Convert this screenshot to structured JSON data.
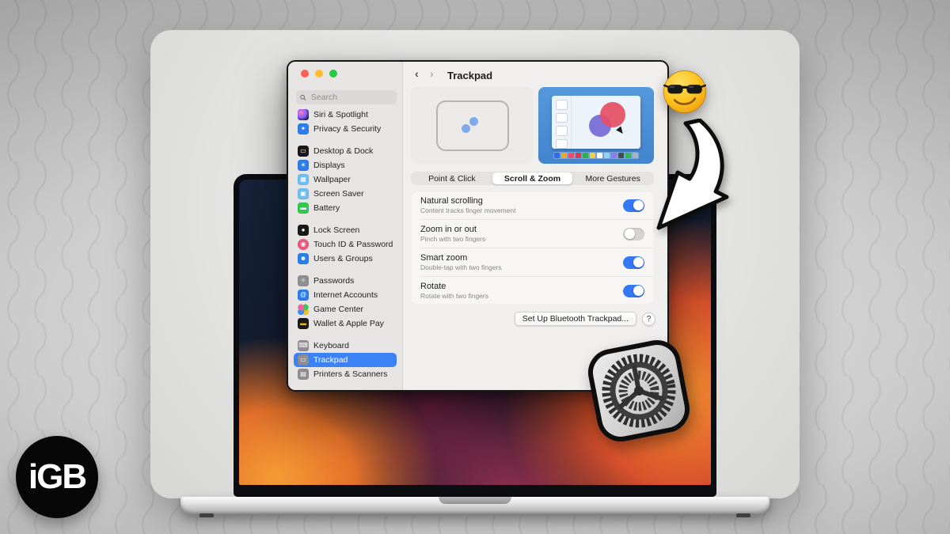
{
  "poster": {
    "logo": {
      "text": "iGB",
      "bg": "#070707",
      "fg": "#ffffff"
    },
    "stickers": [
      "sunglasses-emoji",
      "curved-arrow",
      "system-settings-gear"
    ],
    "background_base_colors": [
      "#888888",
      "#e2e2e2"
    ]
  },
  "window": {
    "title": "Trackpad",
    "search_placeholder": "Search",
    "nav": {
      "back": "‹",
      "forward": "›"
    },
    "traffic_lights": [
      "#ff5f57",
      "#febc2e",
      "#28c840"
    ],
    "accent": "#3478f6",
    "sidebar_groups": [
      {
        "items": [
          {
            "label": "Siri & Spotlight",
            "icon": "siri-spotlight-icon",
            "bg": "radial-gradient(circle at 32% 30%, #ff7ab8 0%, #8a63ff 45%, #17173a 85%)",
            "glyph": ""
          },
          {
            "label": "Privacy & Security",
            "icon": "privacy-security-icon",
            "bg": "#2b7de9",
            "glyph": "✦"
          }
        ]
      },
      {
        "items": [
          {
            "label": "Desktop & Dock",
            "icon": "desktop-dock-icon",
            "bg": "#19191c",
            "glyph": "▭"
          },
          {
            "label": "Displays",
            "icon": "displays-icon",
            "bg": "#2b7de9",
            "glyph": "☀"
          },
          {
            "label": "Wallpaper",
            "icon": "wallpaper-icon",
            "bg": "#6fbef0",
            "glyph": "▦"
          },
          {
            "label": "Screen Saver",
            "icon": "screen-saver-icon",
            "bg": "#6fbef0",
            "glyph": "▣"
          },
          {
            "label": "Battery",
            "icon": "battery-icon",
            "bg": "#32c74f",
            "glyph": "▬"
          }
        ]
      },
      {
        "items": [
          {
            "label": "Lock Screen",
            "icon": "lock-screen-icon",
            "bg": "#19191c",
            "glyph": "●"
          },
          {
            "label": "Touch ID & Password",
            "icon": "touch-id-icon",
            "bg": "#e9577f",
            "glyph": "◉",
            "round": true
          },
          {
            "label": "Users & Groups",
            "icon": "users-groups-icon",
            "bg": "#2b7de9",
            "glyph": "☻"
          }
        ]
      },
      {
        "items": [
          {
            "label": "Passwords",
            "icon": "passwords-icon",
            "bg": "#8e8e93",
            "glyph": "✧"
          },
          {
            "label": "Internet Accounts",
            "icon": "internet-accounts-icon",
            "bg": "#2b7de9",
            "glyph": "@"
          },
          {
            "label": "Game Center",
            "icon": "game-center-icon",
            "bg": "radial-gradient(circle at 30% 32%, #ff5fa2 28%, rgba(0,0,0,0) 30%), radial-gradient(circle at 70% 32%, #45c55a 28%, rgba(0,0,0,0) 30%), radial-gradient(circle at 30% 72%, #3f8df2 28%, rgba(0,0,0,0) 30%), radial-gradient(circle at 70% 72%, #f7c01e 28%, rgba(0,0,0,0) 30%), #f4f4f4",
            "glyph": ""
          },
          {
            "label": "Wallet & Apple Pay",
            "icon": "wallet-icon",
            "bg": "#19191c",
            "glyph": "▬",
            "glyph_color": "#f7b500"
          }
        ]
      },
      {
        "items": [
          {
            "label": "Keyboard",
            "icon": "keyboard-icon",
            "bg": "#8e8e93",
            "glyph": "⌨"
          },
          {
            "label": "Trackpad",
            "icon": "trackpad-icon",
            "bg": "#8e8e93",
            "glyph": "▭",
            "selected": true
          },
          {
            "label": "Printers & Scanners",
            "icon": "printers-scanners-icon",
            "bg": "#8e8e93",
            "glyph": "▤"
          }
        ]
      }
    ],
    "tabs": [
      {
        "label": "Point & Click",
        "selected": false
      },
      {
        "label": "Scroll & Zoom",
        "selected": true
      },
      {
        "label": "More Gestures",
        "selected": false
      }
    ],
    "settings": [
      {
        "label": "Natural scrolling",
        "description": "Content tracks finger movement",
        "enabled": true
      },
      {
        "label": "Zoom in or out",
        "description": "Pinch with two fingers",
        "enabled": false
      },
      {
        "label": "Smart zoom",
        "description": "Double-tap with two fingers",
        "enabled": true
      },
      {
        "label": "Rotate",
        "description": "Rotate with two fingers",
        "enabled": true
      }
    ],
    "footer": {
      "setup_button": "Set Up Bluetooth Trackpad...",
      "help_button": "?"
    },
    "preview": {
      "palette": [
        "#2f6fe4",
        "#f5a623",
        "#e8506a",
        "#d93a4e",
        "#2fae4e",
        "#f7cf3e",
        "#ffffff",
        "#8fd3f2",
        "#8a7fe0",
        "#4a4a4a",
        "#35b558",
        "#aab2ba"
      ],
      "thumb_count": 4
    }
  }
}
